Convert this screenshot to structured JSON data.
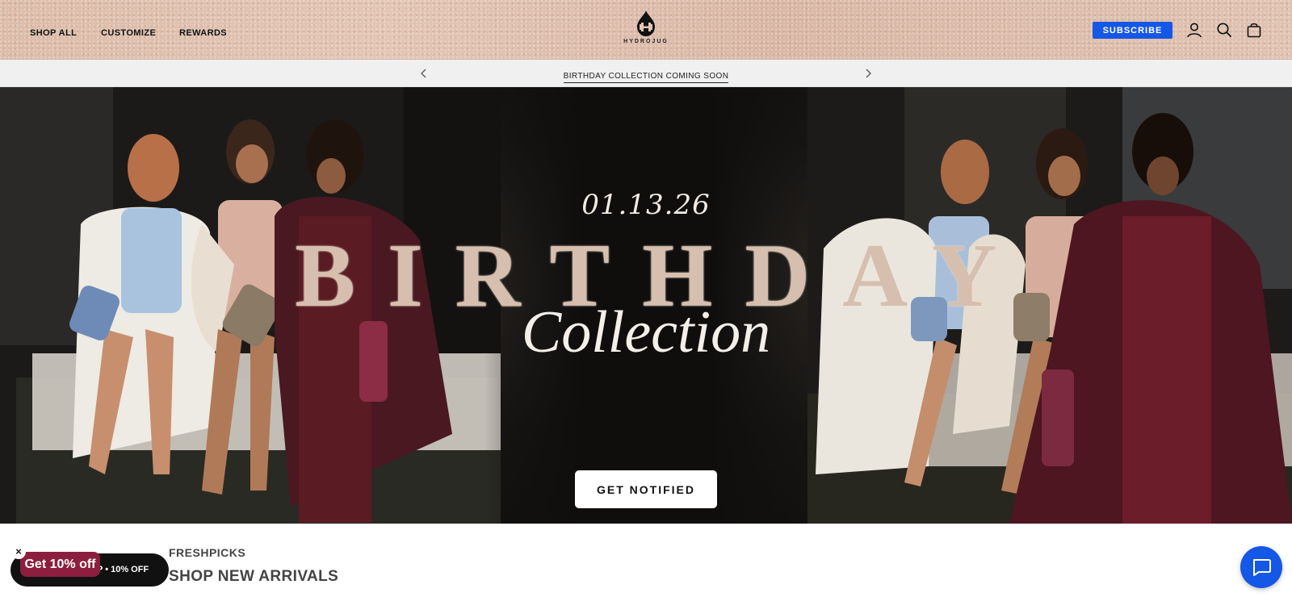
{
  "header": {
    "nav": [
      {
        "label": "SHOP ALL"
      },
      {
        "label": "CUSTOMIZE"
      },
      {
        "label": "REWARDS"
      }
    ],
    "logo_text": "HYDROJUG",
    "subscribe_label": "SUBSCRIBE",
    "icons": [
      "account-icon",
      "search-icon",
      "cart-icon"
    ]
  },
  "announcement": {
    "text": "BIRTHDAY COLLECTION COMING SOON",
    "prev_icon": "chevron-left-icon",
    "next_icon": "chevron-right-icon"
  },
  "hero": {
    "date": "01.13.26",
    "title": "BIRTHDAY",
    "subtitle": "Collection",
    "cta_label": "GET NOTIFIED"
  },
  "section": {
    "eyebrow": "FRESHPICKS",
    "title": "SHOP NEW ARRIVALS"
  },
  "promo": {
    "badge": "Get 10% off",
    "pill_text": "P • 10% OFF",
    "close": "×"
  },
  "colors": {
    "accent": "#1557e6",
    "promo": "#8c1f3f",
    "header_bg": "#dcbdaa"
  }
}
